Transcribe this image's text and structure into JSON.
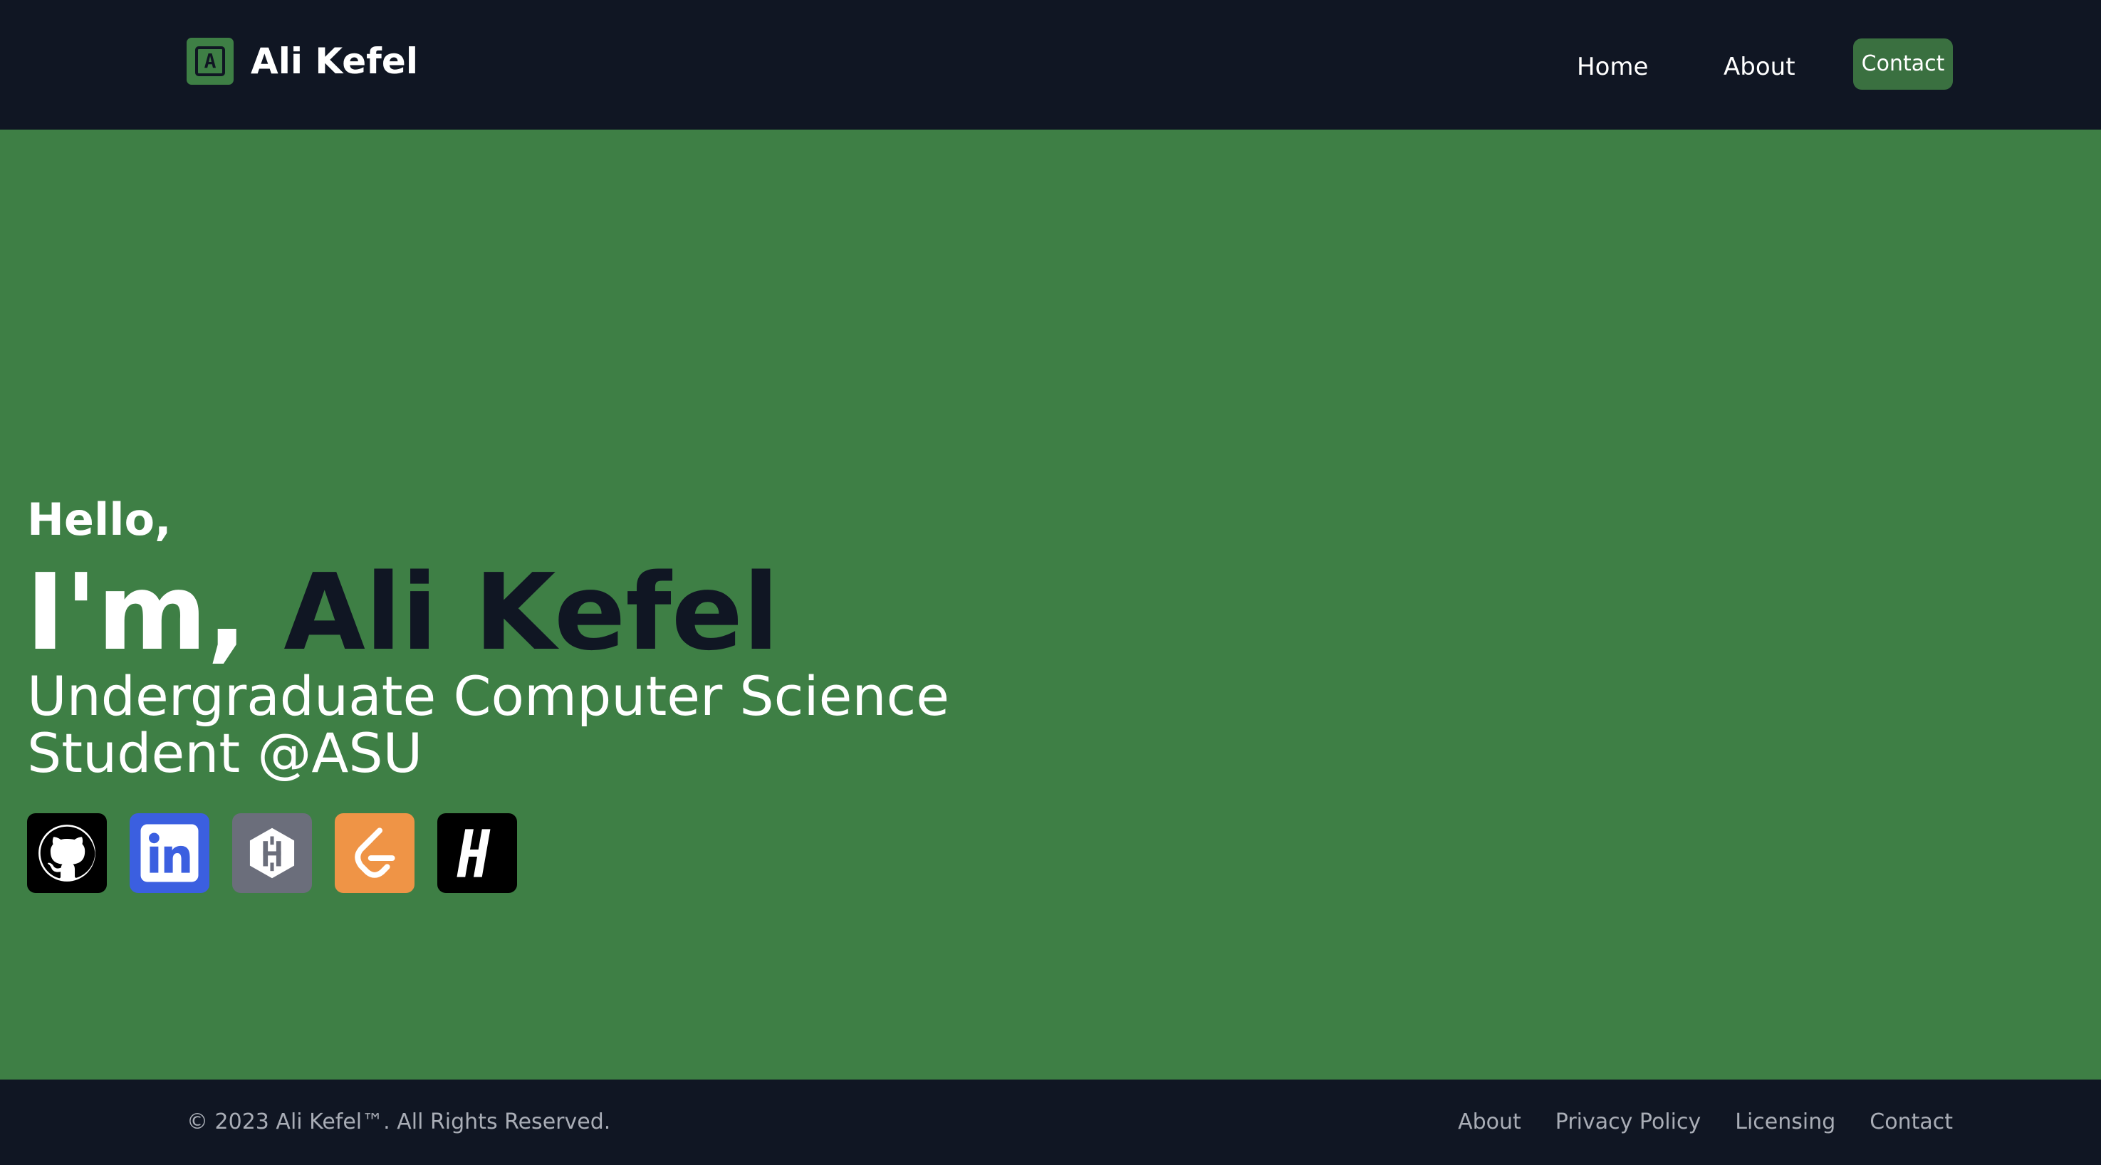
{
  "header": {
    "brand_logo_letter": "A",
    "brand_name": "Ali Kefel",
    "nav": {
      "home": "Home",
      "about": "About",
      "contact": "Contact"
    }
  },
  "hero": {
    "greeting": "Hello,",
    "intro_prefix": "I'm,",
    "name": "Ali Kefel",
    "subtitle": "Undergraduate Computer Science Student @ASU",
    "socials": [
      {
        "icon": "github-icon",
        "bg": "#000000"
      },
      {
        "icon": "linkedin-icon",
        "bg": "#3b5fe0"
      },
      {
        "icon": "hashnode-icon",
        "bg": "#6b6e7b"
      },
      {
        "icon": "leetcode-icon",
        "bg": "#ef9446"
      },
      {
        "icon": "hackerrank-icon",
        "bg": "#000000"
      }
    ]
  },
  "footer": {
    "copyright": "© 2023 Ali Kefel™. All Rights Reserved.",
    "links": {
      "about": "About",
      "privacy": "Privacy Policy",
      "licensing": "Licensing",
      "contact": "Contact"
    }
  },
  "colors": {
    "header_bg": "#101623",
    "page_bg": "#3e7f45",
    "accent_button": "#3a7040",
    "name_text": "#101623"
  }
}
